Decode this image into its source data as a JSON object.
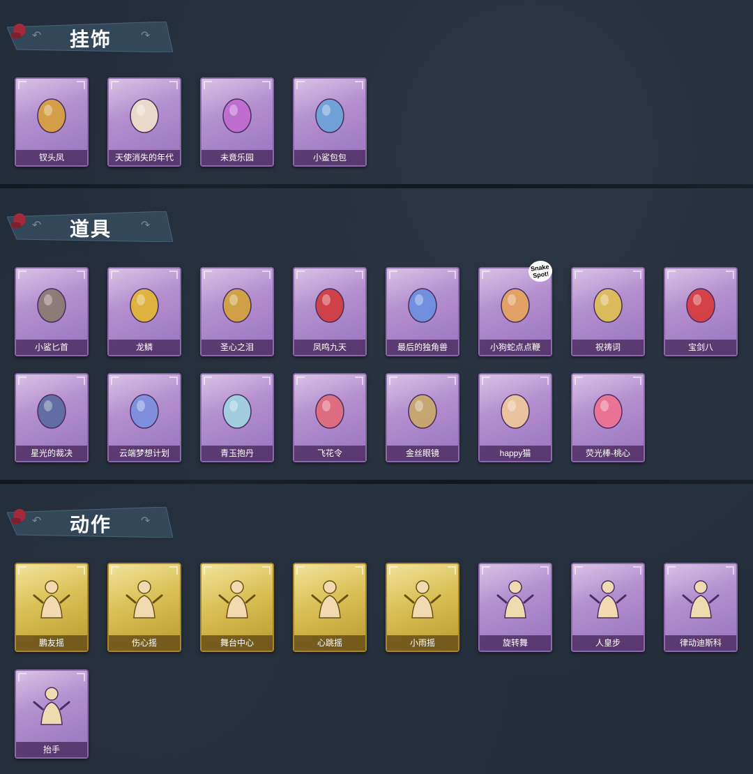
{
  "sections": {
    "pendants": {
      "title": "挂饰"
    },
    "props": {
      "title": "道具"
    },
    "actions": {
      "title": "动作"
    }
  },
  "pendants": [
    {
      "label": "钗头凤",
      "icon": "phoenix-crown-doll-icon",
      "color": "purple"
    },
    {
      "label": "天使消失的年代",
      "icon": "angel-doll-icon",
      "color": "purple"
    },
    {
      "label": "未竟乐园",
      "icon": "rabbit-girl-doll-icon",
      "color": "purple"
    },
    {
      "label": "小鲨包包",
      "icon": "shark-bag-icon",
      "color": "purple"
    }
  ],
  "props": [
    {
      "label": "小鲨匕首",
      "icon": "shark-dagger-icon",
      "color": "purple"
    },
    {
      "label": "龙鳞",
      "icon": "golden-shovel-icon",
      "color": "purple"
    },
    {
      "label": "圣心之泪",
      "icon": "heart-scepter-icon",
      "color": "purple"
    },
    {
      "label": "凤鸣九天",
      "icon": "red-blade-icon",
      "color": "purple"
    },
    {
      "label": "最后的独角兽",
      "icon": "unicorn-blade-icon",
      "color": "purple"
    },
    {
      "label": "小狗蛇点点鞭",
      "icon": "snake-dog-icon",
      "color": "purple"
    },
    {
      "label": "祝祷词",
      "icon": "cross-pendant-icon",
      "color": "purple"
    },
    {
      "label": "宝剑八",
      "icon": "heart-mirror-icon",
      "color": "purple"
    },
    {
      "label": "星光的裁决",
      "icon": "musket-icon",
      "color": "purple"
    },
    {
      "label": "云端梦想计划",
      "icon": "star-mace-icon",
      "color": "purple"
    },
    {
      "label": "青玉抱丹",
      "icon": "jade-bottle-icon",
      "color": "purple"
    },
    {
      "label": "飞花令",
      "icon": "flower-bouquet-icon",
      "color": "purple"
    },
    {
      "label": "金丝眼镜",
      "icon": "glasses-icon",
      "color": "purple"
    },
    {
      "label": "happy猫",
      "icon": "happy-cat-icon",
      "color": "purple"
    },
    {
      "label": "荧光棒-桃心",
      "icon": "heart-wand-icon",
      "color": "purple"
    }
  ],
  "actions": [
    {
      "label": "鹏友摇",
      "icon": "pose-sway-icon",
      "color": "gold"
    },
    {
      "label": "伤心摇",
      "icon": "pose-heart-hands-icon",
      "color": "gold"
    },
    {
      "label": "舞台中心",
      "icon": "pose-point-icon",
      "color": "gold"
    },
    {
      "label": "心跳摇",
      "icon": "pose-heartbeat-icon",
      "color": "gold"
    },
    {
      "label": "小雨摇",
      "icon": "pose-rain-icon",
      "color": "gold"
    },
    {
      "label": "旋转舞",
      "icon": "pose-spin-icon",
      "color": "purple"
    },
    {
      "label": "人皇步",
      "icon": "pose-step-icon",
      "color": "purple"
    },
    {
      "label": "律动迪斯科",
      "icon": "pose-disco-icon",
      "color": "purple"
    },
    {
      "label": "抬手",
      "icon": "pose-raise-hand-icon",
      "color": "purple"
    }
  ],
  "badge": {
    "text": "Snake Spot!"
  }
}
